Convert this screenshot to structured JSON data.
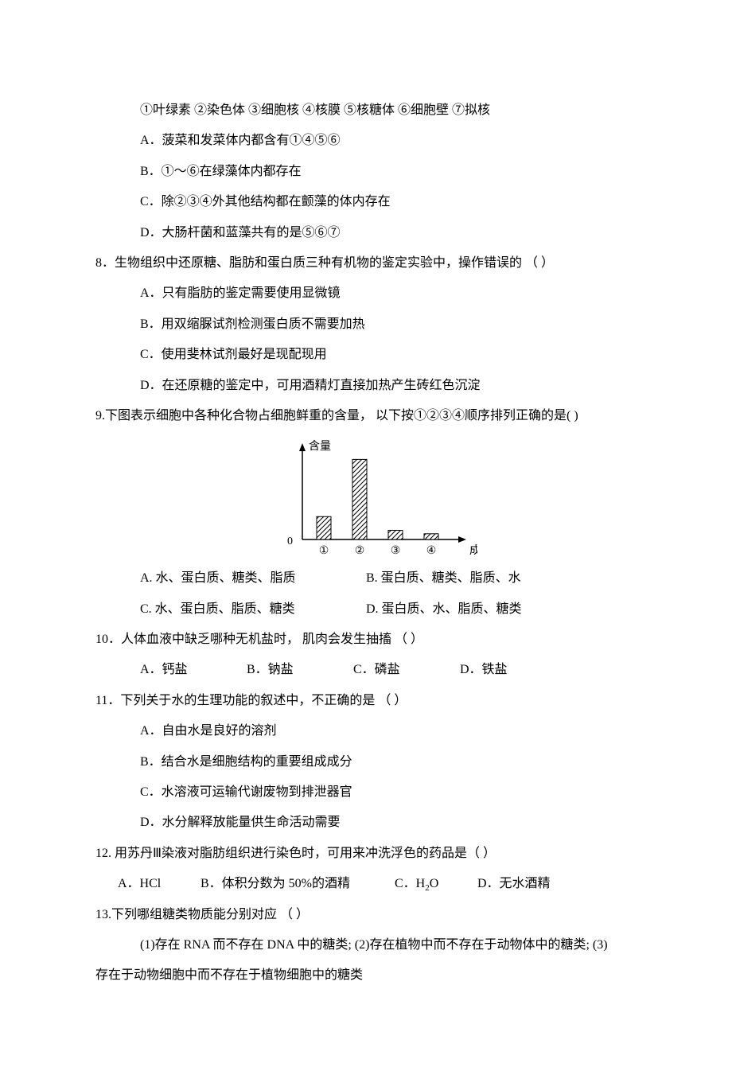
{
  "pre7": {
    "line1": "①叶绿素  ②染色体  ③细胞核  ④核膜  ⑤核糖体  ⑥细胞壁  ⑦拟核",
    "a": "A．菠菜和发菜体内都含有①④⑤⑥",
    "b": "B．①～⑥在绿藻体内都存在",
    "c": "C．除②③④外其他结构都在颤藻的体内存在",
    "d": "D．大肠杆菌和蓝藻共有的是⑤⑥⑦"
  },
  "q8": {
    "stem": "8．生物组织中还原糖、脂肪和蛋白质三种有机物的鉴定实验中，操作错误的 （    ）",
    "a": "A．只有脂肪的鉴定需要使用显微镜",
    "b": "B．用双缩脲试剂检测蛋白质不需要加热",
    "c": "C．使用斐林试剂最好是现配现用",
    "d": "D．在还原糖的鉴定中，可用酒精灯直接加热产生砖红色沉淀"
  },
  "q9": {
    "stem": "9.下图表示细胞中各种化合物占细胞鲜重的含量， 以下按①②③④顺序排列正确的是(     )",
    "a": "A. 水、蛋白质、糖类、脂质",
    "b": "B. 蛋白质、糖类、脂质、水",
    "c": "C. 水、蛋白质、脂质、糖类",
    "d": "D. 蛋白质、水、脂质、糖类"
  },
  "q10": {
    "stem": "10．人体血液中缺乏哪种无机盐时， 肌肉会发生抽搐 （    ）",
    "a": "A．钙盐",
    "b": "B．钠盐",
    "c": "C．磷盐",
    "d": "D．铁盐"
  },
  "q11": {
    "stem": "11．下列关于水的生理功能的叙述中，不正确的是 （    ）",
    "a": "A．自由水是良好的溶剂",
    "b": "B．结合水是细胞结构的重要组成成分",
    "c": "C．水溶液可运输代谢废物到排泄器官",
    "d": "D．水分解释放能量供生命活动需要"
  },
  "q12": {
    "stem": "12. 用苏丹Ⅲ染液对脂肪组织进行染色时，可用来冲洗浮色的药品是（     ）",
    "a": "A．HCl",
    "b": "B．体积分数为 50%的酒精",
    "c_pre": "C．H",
    "c_sub": "2",
    "c_post": "O",
    "d": "D．无水酒精"
  },
  "q13": {
    "stem": "13.下列哪组糖类物质能分别对应 （     ）",
    "line1": "(1)存在 RNA 而不存在 DNA 中的糖类;  (2)存在植物中而不存在于动物体中的糖类;  (3)",
    "line2": "存在于动物细胞中而不存在于植物细胞中的糖类"
  },
  "chart_data": {
    "type": "bar",
    "categories": [
      "①",
      "②",
      "③",
      "④"
    ],
    "values": [
      20,
      70,
      8,
      5
    ],
    "title": "",
    "xlabel": "成分",
    "ylabel": "含量",
    "ylim": [
      0,
      80
    ],
    "origin_label": "0"
  }
}
